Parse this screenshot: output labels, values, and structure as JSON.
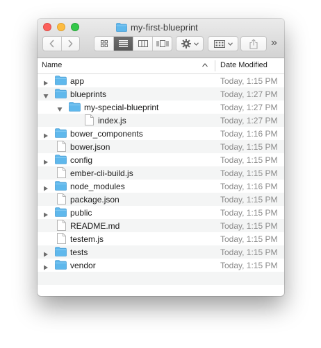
{
  "window": {
    "title": "my-first-blueprint",
    "folder_color": "#5fb8ec"
  },
  "toolbar": {
    "back_icon": "chevron-left-icon",
    "forward_icon": "chevron-right-icon",
    "view_modes": [
      "icon-view-icon",
      "list-view-icon",
      "column-view-icon",
      "cover-flow-icon"
    ],
    "active_view": "list-view-icon",
    "action_icon": "gear-icon",
    "arrange_icon": "arrange-grid-icon",
    "share_icon": "share-icon",
    "overflow_label": "»"
  },
  "columns": {
    "name": "Name",
    "date_modified": "Date Modified"
  },
  "rows": [
    {
      "name": "app",
      "date": "Today, 1:15 PM"
    },
    {
      "name": "blueprints",
      "date": "Today, 1:27 PM"
    },
    {
      "name": "my-special-blueprint",
      "date": "Today, 1:27 PM"
    },
    {
      "name": "index.js",
      "date": "Today, 1:27 PM"
    },
    {
      "name": "bower_components",
      "date": "Today, 1:16 PM"
    },
    {
      "name": "bower.json",
      "date": "Today, 1:15 PM"
    },
    {
      "name": "config",
      "date": "Today, 1:15 PM"
    },
    {
      "name": "ember-cli-build.js",
      "date": "Today, 1:15 PM"
    },
    {
      "name": "node_modules",
      "date": "Today, 1:16 PM"
    },
    {
      "name": "package.json",
      "date": "Today, 1:15 PM"
    },
    {
      "name": "public",
      "date": "Today, 1:15 PM"
    },
    {
      "name": "README.md",
      "date": "Today, 1:15 PM"
    },
    {
      "name": "testem.js",
      "date": "Today, 1:15 PM"
    },
    {
      "name": "tests",
      "date": "Today, 1:15 PM"
    },
    {
      "name": "vendor",
      "date": "Today, 1:15 PM"
    }
  ]
}
